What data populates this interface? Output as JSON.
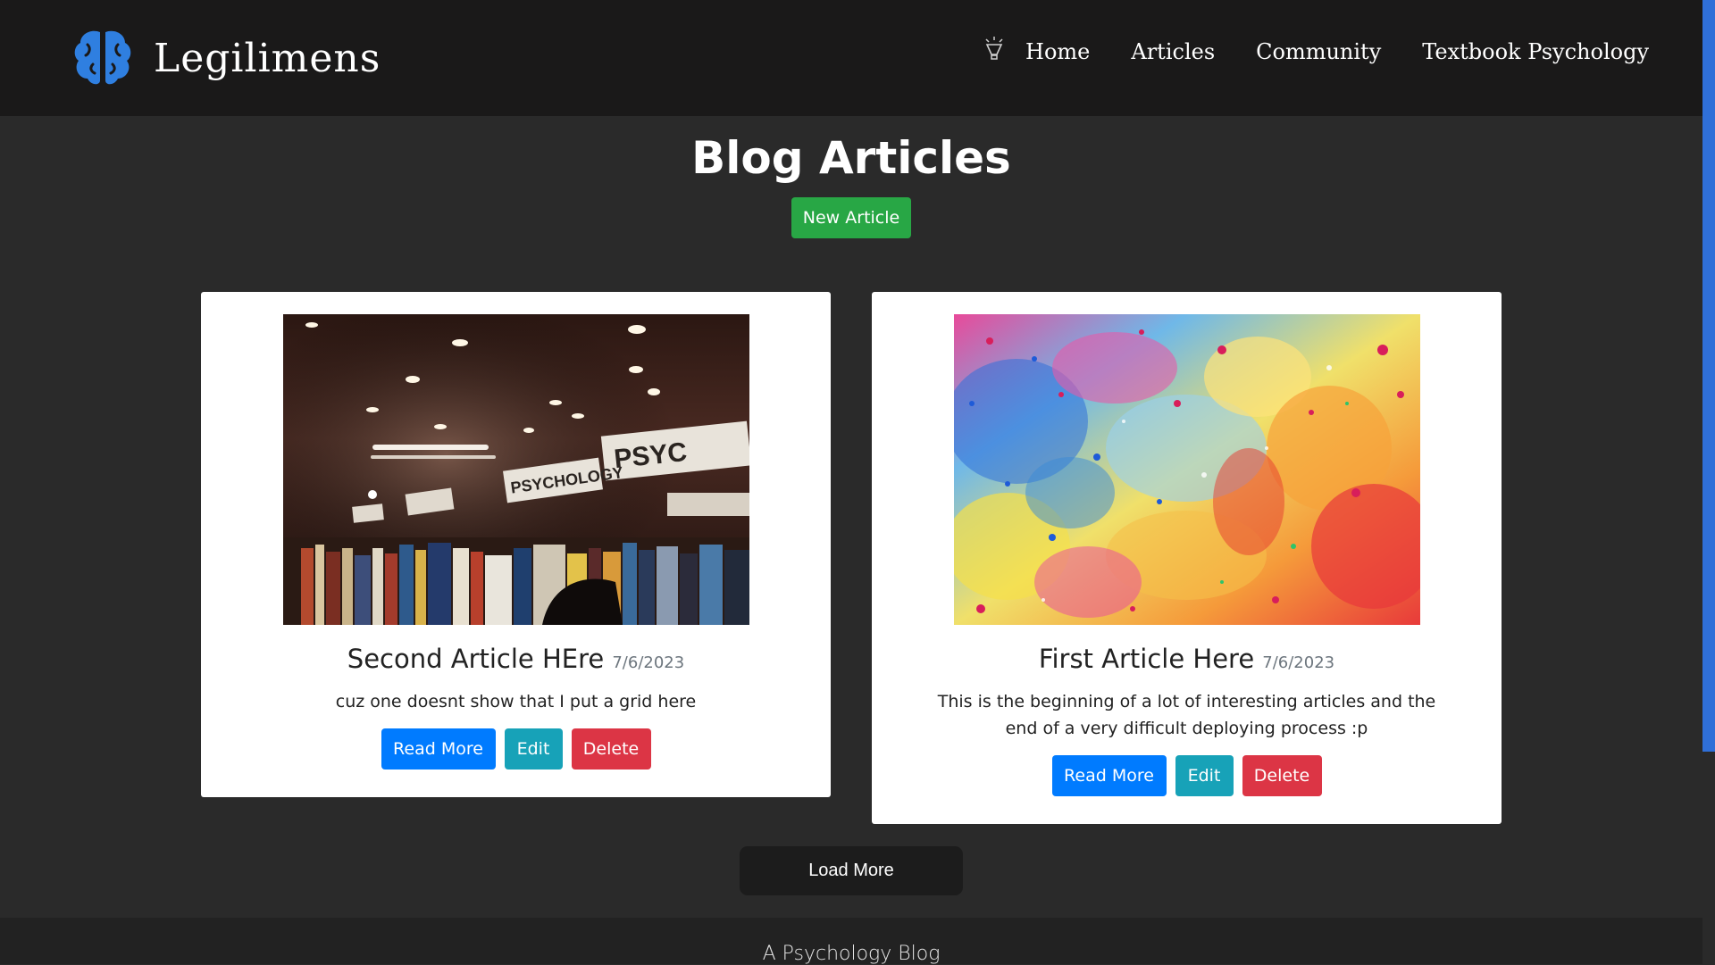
{
  "brand": {
    "name": "Legilimens",
    "logo_icon": "brain-icon"
  },
  "nav": {
    "icon": "lightbulb-icon",
    "links": [
      {
        "label": "Home"
      },
      {
        "label": "Articles"
      },
      {
        "label": "Community"
      },
      {
        "label": "Textbook Psychology"
      }
    ]
  },
  "page": {
    "title": "Blog Articles",
    "new_article_label": "New Article"
  },
  "articles": [
    {
      "title": "Second Article HEre",
      "date": "7/6/2023",
      "excerpt": "cuz one doesnt show that I put a grid here",
      "image": "bookstore-psychology-shelf-photo",
      "read_more": "Read More",
      "edit": "Edit",
      "delete": "Delete"
    },
    {
      "title": "First Article Here",
      "date": "7/6/2023",
      "excerpt": "This is the beginning of a lot of interesting articles and the end of a very difficult deploying process :p",
      "image": "colorful-paint-splatter",
      "read_more": "Read More",
      "edit": "Edit",
      "delete": "Delete"
    }
  ],
  "load_more_label": "Load More",
  "footer": {
    "text": "A Psychology Blog"
  },
  "colors": {
    "navbar_bg": "#1a1919",
    "page_bg": "#2a2a2a",
    "brand_blue": "#2f7fe0",
    "success": "#28a745",
    "primary": "#007bff",
    "info": "#17a2b8",
    "danger": "#dc3545"
  }
}
